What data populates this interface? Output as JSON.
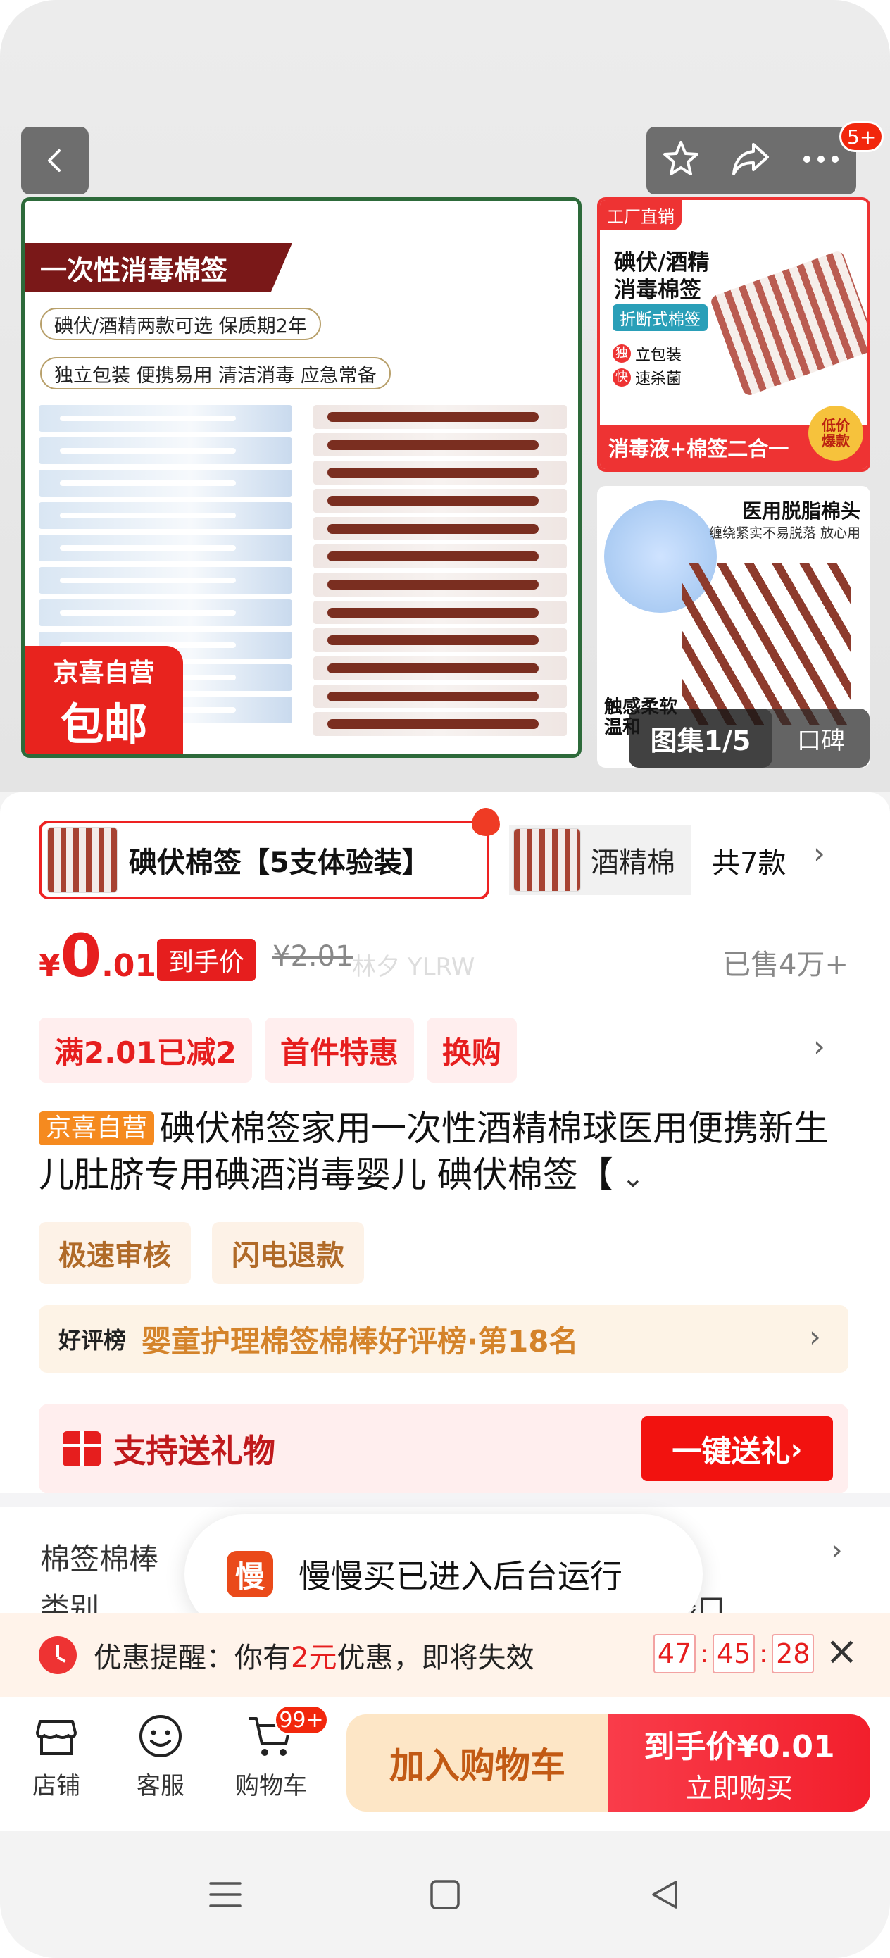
{
  "gallery": {
    "top_badge": "5+",
    "main_image": {
      "banner": "一次性消毒棉签",
      "pill1": "碘伏/酒精两款可选 保质期2年",
      "pill2": "独立包装 便携易用 清洁消毒 应急常备",
      "stamp_line1": "京喜自营",
      "stamp_line2": "包邮"
    },
    "thumb1": {
      "tag": "工厂直销",
      "title": "碘伏/酒精\n消毒棉签",
      "chip": "折断式棉签",
      "feature1_char": "独",
      "feature1": "立包装",
      "feature2_char": "快",
      "feature2": "速杀菌",
      "bottom": "消毒液+棉签二合一",
      "corner": "低价\n爆款"
    },
    "thumb2": {
      "title": "医用脱脂棉头",
      "sub": "缠绕紧实不易脱落 放心用",
      "soft": "触感柔软\n温和"
    },
    "counter": "图集1/5",
    "review": "口碑"
  },
  "variants": {
    "selected": "碘伏棉签【5支体验装】",
    "other": "酒精棉",
    "count": "共7款"
  },
  "price": {
    "currency": "¥",
    "integer": "0",
    "decimal": ".01",
    "tag": "到手价",
    "original": "¥2.01",
    "watermark": "林夕 YLRW",
    "sold": "已售4万+"
  },
  "promos": [
    "满2.01已减2",
    "首件特惠",
    "换购"
  ],
  "title": {
    "tag": "京喜自营",
    "text": "碘伏棉签家用一次性酒精棉球医用便携新生儿肚脐专用碘酒消毒婴儿 碘伏棉签【"
  },
  "services": [
    "极速审核",
    "闪电退款"
  ],
  "rank": {
    "badge": "好评榜",
    "text": "婴童护理棉签棉棒好评榜·第18名"
  },
  "gift": {
    "text": "支持送礼物",
    "button": "一键送礼"
  },
  "spec": {
    "key1": "棉签棉棒",
    "key2": "类别",
    "mid": "钱口"
  },
  "toast": {
    "icon": "慢",
    "text": "慢慢买已进入后台运行"
  },
  "coupon": {
    "prefix": "优惠提醒：你有",
    "amount": "2元",
    "suffix": "优惠，即将失效",
    "hh": "47",
    "mm": "45",
    "ss": "28"
  },
  "bottom": {
    "store": "店铺",
    "service": "客服",
    "cart": "购物车",
    "cart_badge": "99+",
    "add_cart": "加入购物车",
    "buy_price_label": "到手价¥0.01",
    "buy_now": "立即购买"
  }
}
